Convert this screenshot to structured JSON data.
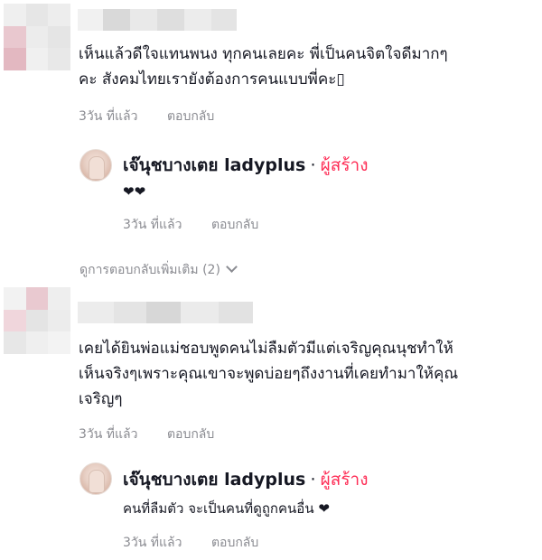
{
  "comments": [
    {
      "text_lines": [
        "เห็นแล้วดีใจแทนพนง ทุกคนเลยคะ พี่เป็นคนจิตใจดีมากๆ",
        "คะ สังคมไทยเรายังต้องการคนแบบพี่คะ▯"
      ],
      "time": "3วัน ที่แล้ว",
      "reply_label": "ตอบกลับ"
    },
    {
      "text_lines": [
        "เคยได้ยินพ่อแม่ชอบพูดคนไม่ลืมตัวมีแต่เจริญคุณนุชทำให้",
        "เห็นจริงๆเพราะคุณเขาจะพูดบ่อยๆถึงงานที่เคยทำมาให้คุณ",
        "เจริญๆ"
      ],
      "time": "3วัน ที่แล้ว",
      "reply_label": "ตอบกลับ"
    }
  ],
  "replies": [
    {
      "author": "เจ๊นุชบางเตย ladyplus",
      "separator": "·",
      "badge": "ผู้สร้าง",
      "text": "❤❤",
      "time": "3วัน ที่แล้ว",
      "reply_label": "ตอบกลับ"
    },
    {
      "author": "เจ๊นุชบางเตย ladyplus",
      "separator": "·",
      "badge": "ผู้สร้าง",
      "text": "คนที่ลืมตัว จะเป็นคนที่ดูถูกคนอื่น ❤",
      "time": "3วัน ที่แล้ว",
      "reply_label": "ตอบกลับ"
    }
  ],
  "view_more_replies": "ดูการตอบกลับเพิ่มเติม (2)",
  "colors": {
    "creator_badge": "#fe2c55",
    "meta_text": "#8a8b91",
    "body_text": "#161823"
  }
}
